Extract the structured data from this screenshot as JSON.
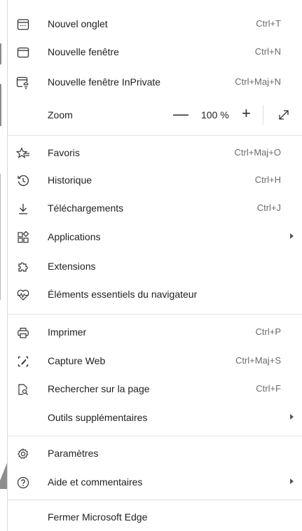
{
  "menu": {
    "new_tab": {
      "label": "Nouvel onglet",
      "shortcut": "Ctrl+T"
    },
    "new_window": {
      "label": "Nouvelle fenêtre",
      "shortcut": "Ctrl+N"
    },
    "new_inprivate": {
      "label": "Nouvelle fenêtre InPrivate",
      "shortcut": "Ctrl+Maj+N"
    },
    "zoom": {
      "label": "Zoom",
      "value": "100 %",
      "minus": "—",
      "plus": "+"
    },
    "favorites": {
      "label": "Favoris",
      "shortcut": "Ctrl+Maj+O"
    },
    "history": {
      "label": "Historique",
      "shortcut": "Ctrl+H"
    },
    "downloads": {
      "label": "Téléchargements",
      "shortcut": "Ctrl+J"
    },
    "apps": {
      "label": "Applications"
    },
    "extensions": {
      "label": "Extensions"
    },
    "essentials": {
      "label": "Éléments essentiels du navigateur"
    },
    "print": {
      "label": "Imprimer",
      "shortcut": "Ctrl+P"
    },
    "web_capture": {
      "label": "Capture Web",
      "shortcut": "Ctrl+Maj+S"
    },
    "find": {
      "label": "Rechercher sur la page",
      "shortcut": "Ctrl+F"
    },
    "more_tools": {
      "label": "Outils supplémentaires"
    },
    "settings": {
      "label": "Paramètres"
    },
    "help": {
      "label": "Aide et commentaires"
    },
    "close_edge": {
      "label": "Fermer Microsoft Edge"
    }
  },
  "icons": {
    "new_tab": "new-tab-icon",
    "new_window": "window-icon",
    "inprivate": "inprivate-window-icon",
    "favorites": "favorites-star-icon",
    "history": "history-clock-icon",
    "downloads": "download-arrow-icon",
    "apps": "apps-grid-icon",
    "extensions": "puzzle-icon",
    "essentials": "heart-pulse-icon",
    "print": "printer-icon",
    "capture": "web-capture-icon",
    "find": "find-page-icon",
    "settings": "gear-icon",
    "help": "help-circle-icon",
    "fullscreen": "fullscreen-expand-icon"
  },
  "colors": {
    "text": "#1f1f1f",
    "shortcut": "#6b6b6b",
    "separator": "#e3e3e3"
  }
}
